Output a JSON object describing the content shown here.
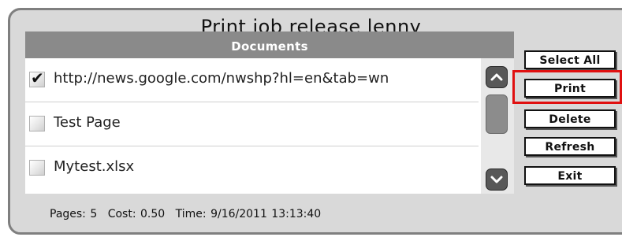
{
  "window": {
    "title": "Print job release lenny"
  },
  "list": {
    "header": "Documents",
    "items": [
      {
        "label": "http://news.google.com/nwshp?hl=en&tab=wn",
        "checked": true
      },
      {
        "label": "Test Page",
        "checked": false
      },
      {
        "label": "Mytest.xlsx",
        "checked": false
      }
    ]
  },
  "status": {
    "pages": "Pages: 5",
    "cost": "Cost: 0.50",
    "time": "Time: 9/16/2011 13:13:40"
  },
  "buttons": {
    "select_all": "Select All",
    "print": "Print",
    "delete": "Delete",
    "refresh": "Refresh",
    "exit": "Exit"
  },
  "highlight_color": "#e01010",
  "icons": {
    "checkmark": "✔",
    "scroll_up": "chevron-up-icon",
    "scroll_down": "chevron-down-icon"
  }
}
